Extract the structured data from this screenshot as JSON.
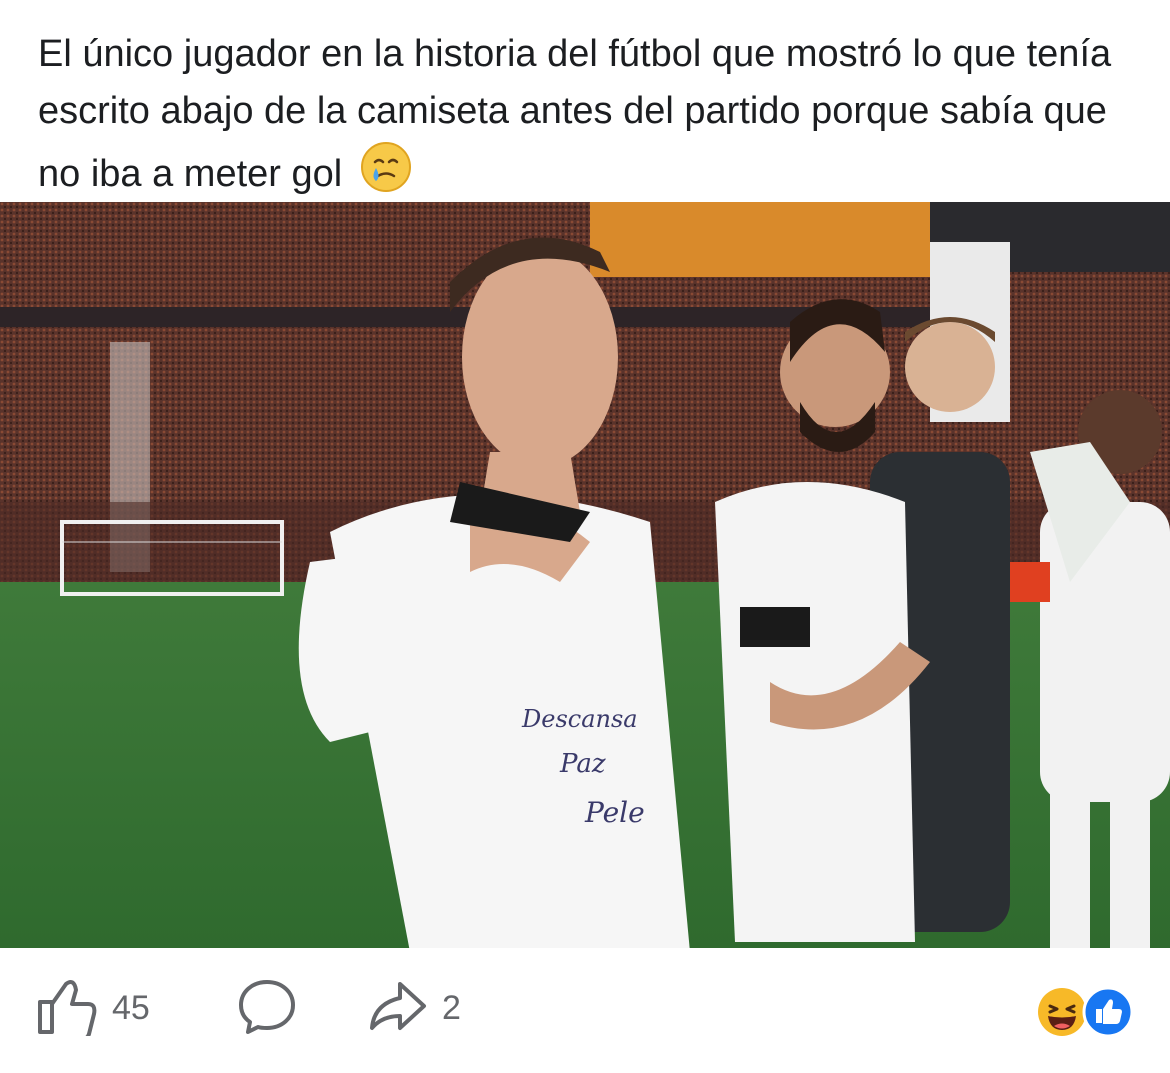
{
  "post": {
    "text": "El único jugador en la historia del fútbol que mostró lo que tenía escrito abajo de la camiseta antes del partido porque sabía que no iba a meter gol",
    "text_emoji": "crying-face-emoji"
  },
  "photo": {
    "shirt_writing": [
      "Descansa",
      "Paz",
      "Pele"
    ]
  },
  "actions": {
    "like_icon": "thumbs-up-icon",
    "like_count": "45",
    "comment_icon": "comment-bubble-icon",
    "share_icon": "share-arrow-icon",
    "share_count": "2"
  },
  "reactions": [
    "haha-reaction-icon",
    "like-reaction-icon"
  ],
  "colors": {
    "reaction_like_blue": "#1877f2",
    "reaction_haha_yellow": "#f7b928",
    "icon_gray": "#65676b"
  }
}
